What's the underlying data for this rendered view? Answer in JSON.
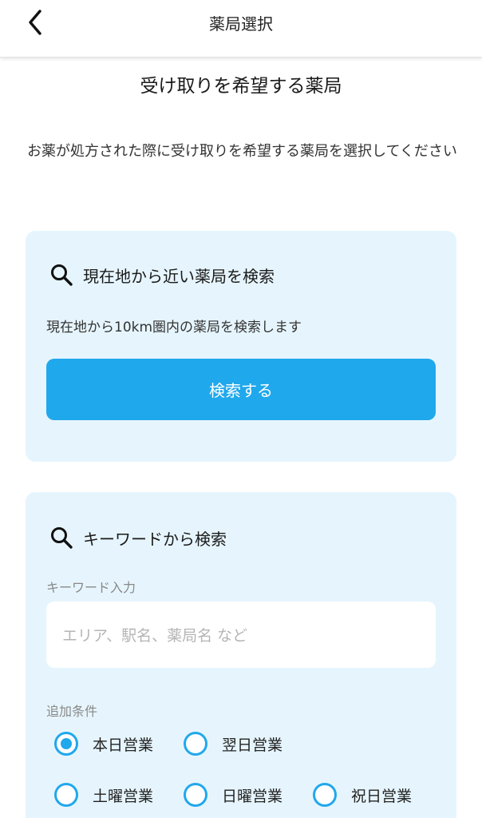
{
  "header": {
    "title": "薬局選択",
    "back_icon": "chevron-left-icon"
  },
  "page": {
    "heading": "受け取りを希望する薬局",
    "description": "お薬が処方された際に受け取りを希望する薬局を選択してください"
  },
  "nearby_search": {
    "title": "現在地から近い薬局を検索",
    "icon": "search-icon",
    "description": "現在地から10km圏内の薬局を検索します",
    "button_label": "検索する"
  },
  "keyword_search": {
    "title": "キーワードから検索",
    "icon": "search-icon",
    "input_label": "キーワード入力",
    "input_value": "",
    "input_placeholder": "エリア、駅名、薬局名 など",
    "conditions_label": "追加条件",
    "conditions": [
      {
        "label": "本日営業",
        "selected": true
      },
      {
        "label": "翌日営業",
        "selected": false
      },
      {
        "label": "土曜営業",
        "selected": false
      },
      {
        "label": "日曜営業",
        "selected": false
      },
      {
        "label": "祝日営業",
        "selected": false
      }
    ]
  },
  "colors": {
    "accent": "#20a8ec",
    "card_background": "#e6f5fd"
  }
}
